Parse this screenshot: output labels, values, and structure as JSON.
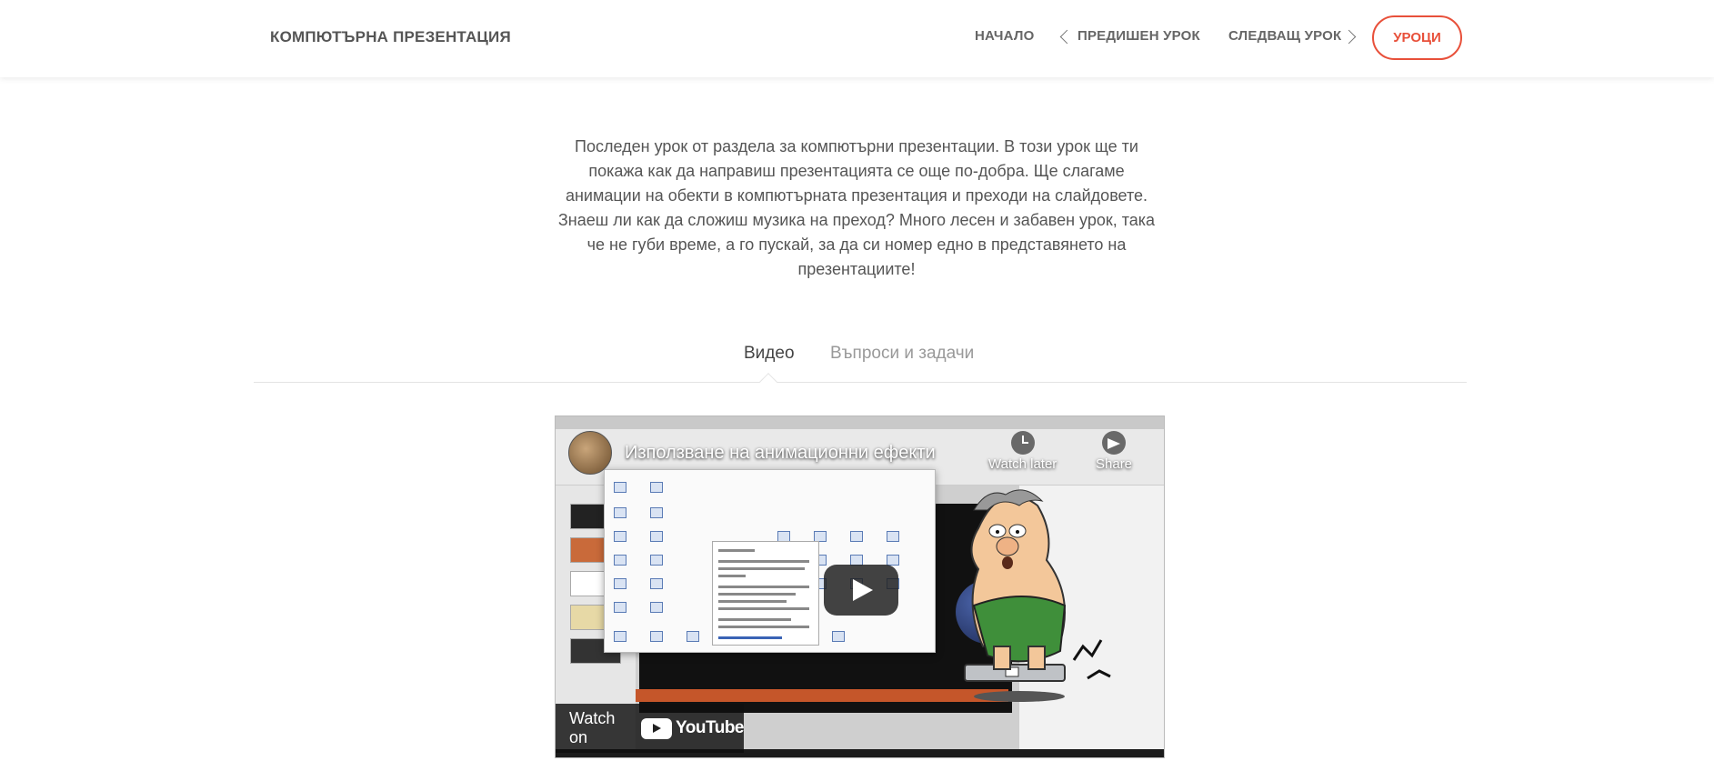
{
  "header": {
    "brand": "КОМПЮТЪРНА ПРЕЗЕНТАЦИЯ",
    "nav_home": "НАЧАЛО",
    "nav_prev": "ПРЕДИШЕН УРОК",
    "nav_next": "СЛЕДВАЩ УРОК",
    "lessons_button": "УРОЦИ",
    "accent_color": "#e8503a"
  },
  "intro": {
    "text": "Последен урок от раздела за компютърни презентации. В този урок ще ти покажа как да направиш презентацията се още по-добра. Ще слагаме анимации на обекти в компютърната презентация и преходи на слайдовете. Знаеш ли как да сложиш музика на преход? Много лесен и забавен урок, така че не губи време, а го пускай, за да си номер едно в представянето на презентациите!"
  },
  "tabs": [
    {
      "label": "Видео",
      "active": true
    },
    {
      "label": "Въпроси и задачи",
      "active": false
    }
  ],
  "video": {
    "title": "Използване на анимационни ефекти",
    "watch_later_label": "Watch later",
    "share_label": "Share",
    "watch_on_label": "Watch on",
    "youtube_label": "YouTube",
    "icons": [
      "clock-icon",
      "share-icon",
      "play-icon",
      "youtube-logo-icon"
    ]
  }
}
